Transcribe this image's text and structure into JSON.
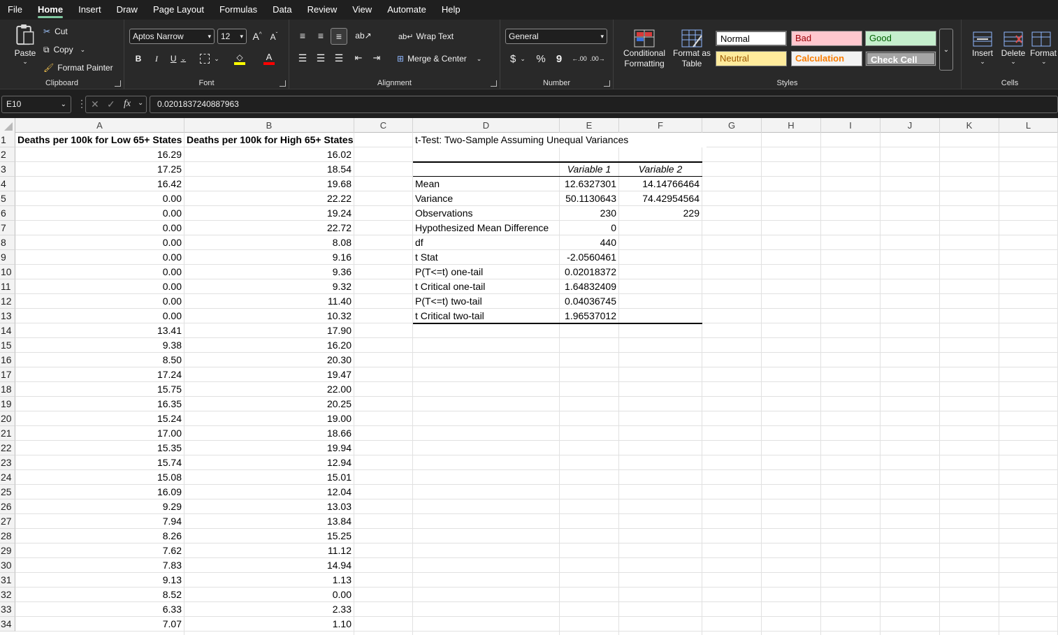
{
  "menu": [
    "File",
    "Home",
    "Insert",
    "Draw",
    "Page Layout",
    "Formulas",
    "Data",
    "Review",
    "View",
    "Automate",
    "Help"
  ],
  "active_menu": "Home",
  "clipboard": {
    "paste": "Paste",
    "cut": "Cut",
    "copy": "Copy",
    "format_painter": "Format Painter",
    "label": "Clipboard"
  },
  "font": {
    "name": "Aptos Narrow",
    "size": "12",
    "label": "Font",
    "bold": "B",
    "italic": "I",
    "underline": "U",
    "grow": "A^",
    "shrink": "A˅",
    "font_color": "#ff0000",
    "fill_color": "#ffff00"
  },
  "alignment": {
    "wrap_text": "Wrap Text",
    "merge_center": "Merge & Center",
    "label": "Alignment"
  },
  "number": {
    "format": "General",
    "currency": "$",
    "percent": "%",
    "comma": "9",
    "label": "Number"
  },
  "styles_group": {
    "conditional_formatting": "Conditional Formatting",
    "format_as_table": "Format as Table",
    "label": "Styles",
    "normal": "Normal",
    "bad": "Bad",
    "good": "Good",
    "neutral": "Neutral",
    "calculation": "Calculation",
    "check_cell": "Check Cell"
  },
  "cells_group": {
    "insert": "Insert",
    "delete": "Delete",
    "format": "Format",
    "label": "Cells"
  },
  "formula_bar": {
    "name_box": "E10",
    "formula": "0.0201837240887963",
    "fx": "fx"
  },
  "columns": [
    "A",
    "B",
    "C",
    "D",
    "E",
    "F",
    "G",
    "H",
    "I",
    "J",
    "K",
    "L"
  ],
  "rows": [
    "1",
    "2",
    "3",
    "4",
    "5",
    "6",
    "7",
    "8",
    "9",
    "10",
    "11",
    "12",
    "13",
    "14",
    "15",
    "16",
    "17",
    "18",
    "19",
    "20",
    "21",
    "22",
    "23",
    "24",
    "25",
    "26",
    "27",
    "28",
    "29",
    "30",
    "31",
    "32",
    "33",
    "34"
  ],
  "header_A": "Deaths per 100k for Low 65+ States",
  "header_B": "Deaths per 100k for High 65+ States",
  "col_A": [
    "16.29",
    "17.25",
    "16.42",
    "0.00",
    "0.00",
    "0.00",
    "0.00",
    "0.00",
    "0.00",
    "0.00",
    "0.00",
    "0.00",
    "13.41",
    "9.38",
    "8.50",
    "17.24",
    "15.75",
    "16.35",
    "15.24",
    "17.00",
    "15.35",
    "15.74",
    "15.08",
    "16.09",
    "9.29",
    "7.94",
    "8.26",
    "7.62",
    "7.83",
    "9.13",
    "8.52",
    "6.33",
    "7.07"
  ],
  "col_B": [
    "16.02",
    "18.54",
    "19.68",
    "22.22",
    "19.24",
    "22.72",
    "8.08",
    "9.16",
    "9.36",
    "9.32",
    "11.40",
    "10.32",
    "17.90",
    "16.20",
    "20.30",
    "19.47",
    "22.00",
    "20.25",
    "19.00",
    "18.66",
    "19.94",
    "12.94",
    "15.01",
    "12.04",
    "13.03",
    "13.84",
    "15.25",
    "11.12",
    "14.94",
    "1.13",
    "0.00",
    "2.33",
    "1.10"
  ],
  "ttest": {
    "title": "t-Test: Two-Sample Assuming Unequal Variances",
    "var1": "Variable 1",
    "var2": "Variable 2",
    "rows": [
      {
        "label": "Mean",
        "v1": "12.6327301",
        "v2": "14.14766464"
      },
      {
        "label": "Variance",
        "v1": "50.1130643",
        "v2": "74.42954564"
      },
      {
        "label": "Observations",
        "v1": "230",
        "v2": "229"
      },
      {
        "label": "Hypothesized Mean Difference",
        "v1": "0",
        "v2": ""
      },
      {
        "label": "df",
        "v1": "440",
        "v2": ""
      },
      {
        "label": "t Stat",
        "v1": "-2.0560461",
        "v2": ""
      },
      {
        "label": "P(T<=t) one-tail",
        "v1": "0.02018372",
        "v2": ""
      },
      {
        "label": "t Critical one-tail",
        "v1": "1.64832409",
        "v2": ""
      },
      {
        "label": "P(T<=t) two-tail",
        "v1": "0.04036745",
        "v2": ""
      },
      {
        "label": "t Critical two-tail",
        "v1": "1.96537012",
        "v2": ""
      }
    ]
  }
}
